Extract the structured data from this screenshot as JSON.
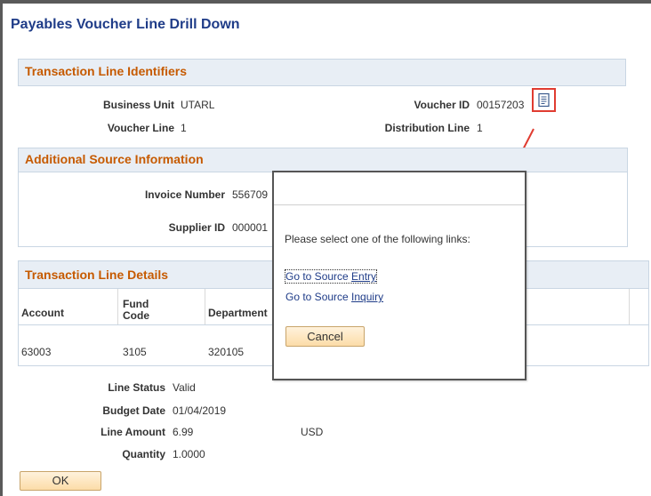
{
  "page": {
    "title": "Payables Voucher Line Drill Down"
  },
  "identifiers": {
    "header": "Transaction Line Identifiers",
    "business_unit_label": "Business Unit",
    "business_unit": "UTARL",
    "voucher_line_label": "Voucher Line",
    "voucher_line": "1",
    "voucher_id_label": "Voucher ID",
    "voucher_id": "00157203",
    "distribution_line_label": "Distribution Line",
    "distribution_line": "1"
  },
  "source_info": {
    "header": "Additional Source Information",
    "invoice_number_label": "Invoice Number",
    "invoice_number": "556709",
    "supplier_id_label": "Supplier ID",
    "supplier_id": "000001"
  },
  "details": {
    "header": "Transaction Line Details",
    "columns": [
      "Account",
      "Fund Code",
      "Department"
    ],
    "row": {
      "account": "63003",
      "fund_code": "3105",
      "department": "320105"
    }
  },
  "summary": {
    "line_status_label": "Line Status",
    "line_status": "Valid",
    "budget_date_label": "Budget Date",
    "budget_date": "01/04/2019",
    "line_amount_label": "Line Amount",
    "line_amount": "6.99",
    "currency": "USD",
    "quantity_label": "Quantity",
    "quantity": "1.0000"
  },
  "buttons": {
    "ok": "OK"
  },
  "popup": {
    "prompt": "Please select one of the following links:",
    "link_entry_pre": "Go to Source ",
    "link_entry_u": "Entry",
    "link_inquiry_pre": "Go to Source ",
    "link_inquiry_u": "Inquiry",
    "cancel": "Cancel"
  },
  "colors": {
    "section_header_text": "#c65a00",
    "link": "#1f3c88",
    "highlight": "#e03c31"
  },
  "icons": {
    "drill_down": "document-drill-icon"
  }
}
